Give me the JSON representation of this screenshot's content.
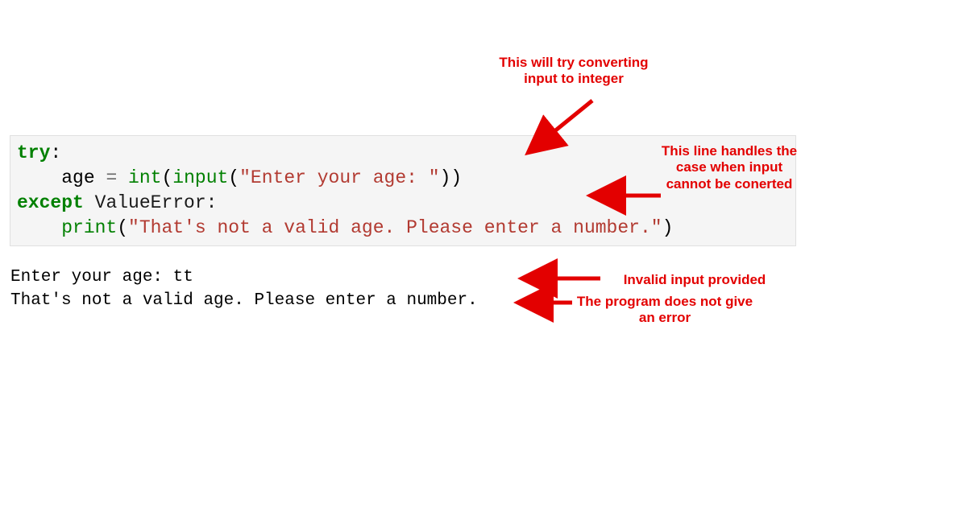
{
  "code": {
    "line1": {
      "kw": "try",
      "colon": ":"
    },
    "line2": {
      "indent": "    ",
      "var": "age ",
      "eq": "= ",
      "fn": "int",
      "paren1": "(",
      "fn2": "input",
      "paren2": "(",
      "str": "\"Enter your age: \"",
      "close": "))"
    },
    "line3": {
      "kw": "except",
      "sp": " ",
      "exc": "ValueError:",
      "colon": ""
    },
    "line4": {
      "indent": "    ",
      "fn": "print",
      "paren": "(",
      "str": "\"That's not a valid age. Please enter a number.\"",
      "close": ")"
    }
  },
  "output": {
    "line1": "Enter your age: tt",
    "line2": "That's not a valid age. Please enter a number."
  },
  "annotations": {
    "a1": "This will try converting input to integer",
    "a2": "This line handles the case when input cannot be conerted",
    "a3": "Invalid input provided",
    "a4": "The program does not give an error"
  },
  "colors": {
    "annotation": "#E30000",
    "keyword": "#008000",
    "string": "#B23A31"
  }
}
